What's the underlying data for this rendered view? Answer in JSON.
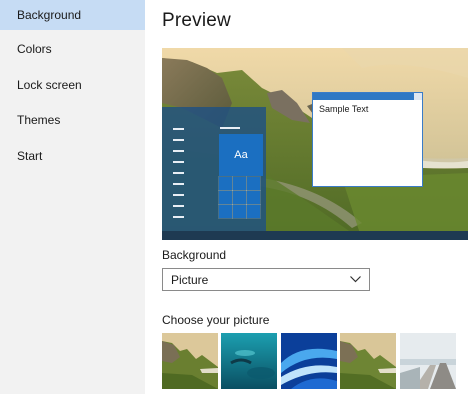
{
  "sidebar": {
    "items": [
      {
        "label": "Background",
        "active": true
      },
      {
        "label": "Colors",
        "active": false
      },
      {
        "label": "Lock screen",
        "active": false
      },
      {
        "label": "Themes",
        "active": false
      },
      {
        "label": "Start",
        "active": false
      }
    ]
  },
  "main": {
    "title": "Preview",
    "preview": {
      "tile_label": "Aa",
      "sample_text": "Sample Text"
    },
    "background": {
      "label": "Background",
      "selected": "Picture"
    },
    "choose_picture": {
      "label": "Choose your picture",
      "thumbnails": [
        {
          "name": "mountain-landscape"
        },
        {
          "name": "underwater-scene"
        },
        {
          "name": "blue-abstract-wave"
        },
        {
          "name": "mountain-landscape-2"
        },
        {
          "name": "coastal-walkway"
        }
      ]
    }
  },
  "colors": {
    "accent": "#1b6fc1",
    "nav_active": "#c6dcf4",
    "sidebar_bg": "#f2f2f2"
  }
}
